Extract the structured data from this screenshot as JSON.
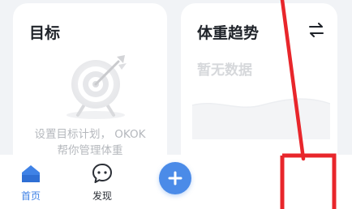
{
  "goal_card": {
    "title": "目标",
    "hint_line1": "设置目标计划， OKOK",
    "hint_line2": "帮你管理体重"
  },
  "trend_card": {
    "title": "体重趋势",
    "no_data": "暂无数据",
    "swap_icon": "swap-arrows-icon"
  },
  "tabbar": {
    "home_label": "首页",
    "discover_label": "发现",
    "add_icon": "plus-icon"
  },
  "colors": {
    "accent": "#3f82e6",
    "add_button": "#4b8be8",
    "annotation": "#e8262b",
    "hint_text": "#b5b8bd"
  }
}
